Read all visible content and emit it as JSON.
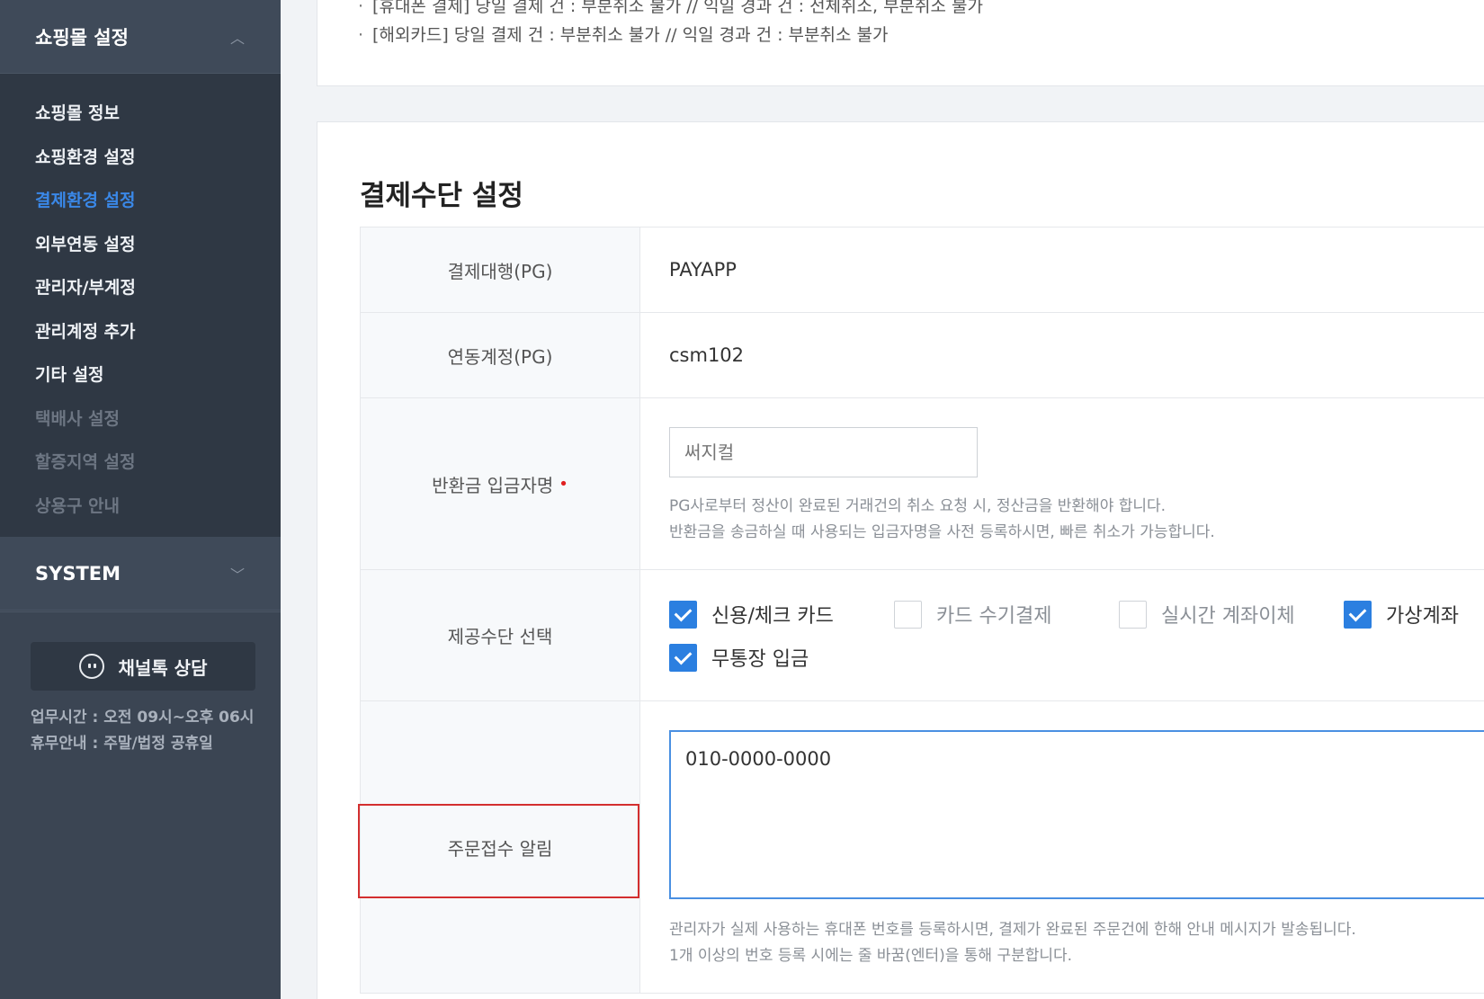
{
  "sidebar": {
    "group1_title": "쇼핑몰 설정",
    "items": [
      {
        "label": "쇼핑몰 정보",
        "state": "normal"
      },
      {
        "label": "쇼핑환경 설정",
        "state": "normal"
      },
      {
        "label": "결제환경 설정",
        "state": "active"
      },
      {
        "label": "외부연동 설정",
        "state": "normal"
      },
      {
        "label": "관리자/부계정",
        "state": "normal"
      },
      {
        "label": "관리계정 추가",
        "state": "normal"
      },
      {
        "label": "기타 설정",
        "state": "normal"
      },
      {
        "label": "택배사 설정",
        "state": "disabled"
      },
      {
        "label": "할증지역 설정",
        "state": "disabled"
      },
      {
        "label": "상용구 안내",
        "state": "disabled"
      }
    ],
    "group2_title": "SYSTEM",
    "chat_button": "채널톡 상담",
    "work_hours": "업무시간 : 오전 09시~오후 06시",
    "holiday": "휴무안내 : 주말/법정 공휴일"
  },
  "notices": [
    "[휴대폰 결제] 당일 결제 건 : 부분취소 불가 // 익일 경과 건 : 전체취소, 부분취소 불가",
    "[해외카드] 당일 결제 건 : 부분취소 불가 // 익일 경과 건 : 부분취소 불가"
  ],
  "section_title": "결제수단 설정",
  "form": {
    "pg_label": "결제대행(PG)",
    "pg_value": "PAYAPP",
    "account_label": "연동계정(PG)",
    "account_value": "csm102",
    "refund_label": "반환금 입금자명",
    "refund_required_mark": "•",
    "refund_placeholder": "써지컬",
    "refund_help1": "PG사로부터 정산이 완료된 거래건의 취소 요청 시, 정산금을 반환해야 합니다.",
    "refund_help2": "반환금을 송금하실 때 사용되는 입금자명을 사전 등록하시면, 빠른 취소가 가능합니다.",
    "methods_label": "제공수단 선택",
    "methods": [
      {
        "label": "신용/체크 카드",
        "checked": true
      },
      {
        "label": "카드 수기결제",
        "checked": false
      },
      {
        "label": "실시간 계좌이체",
        "checked": false
      },
      {
        "label": "가상계좌",
        "checked": true
      },
      {
        "label": "무통장 입금",
        "checked": true
      }
    ],
    "order_alert_label": "주문접수 알림",
    "order_alert_value": "010-0000-0000",
    "order_help1": "관리자가 실제 사용하는 휴대폰 번호를 등록하시면, 결제가 완료된 주문건에 한해 안내 메시지가 발송됩니다.",
    "order_help2": "1개 이상의 번호 등록 시에는 줄 바꿈(엔터)을 통해 구분합니다."
  },
  "colors": {
    "sidebar_bg": "#2f3844",
    "active_menu": "#3a88e8",
    "checkbox_checked": "#2b7fe0",
    "highlight_border": "#d32f2f"
  }
}
